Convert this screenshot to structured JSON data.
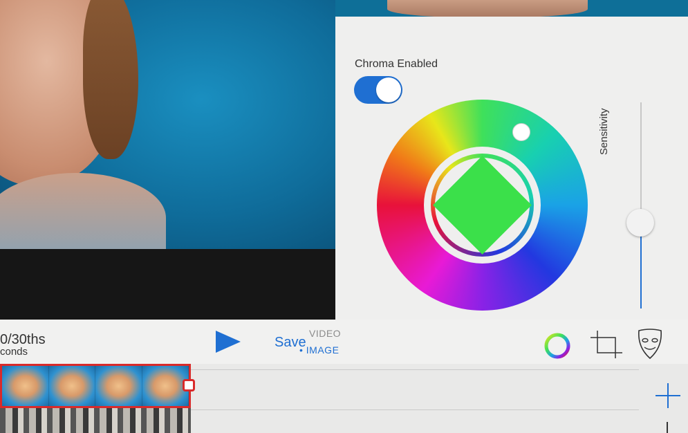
{
  "chroma": {
    "label": "Chroma Enabled",
    "enabled": true,
    "sensitivity_label": "Sensitivity",
    "key_color": "#3be04a",
    "toggle_color": "#1f6fd2"
  },
  "toolbar": {
    "duration_value": "0/30ths",
    "duration_unit": "conds",
    "save_label": "Save",
    "mode_video": "VIDEO",
    "mode_image": "• IMAGE",
    "accent": "#1f6fd2",
    "icons": [
      "play-icon",
      "color-wheel-icon",
      "crop-icon",
      "mask-icon",
      "plus-icon"
    ]
  },
  "timeline": {
    "clip_border_color": "#d92a2a",
    "frame_count": 4
  }
}
